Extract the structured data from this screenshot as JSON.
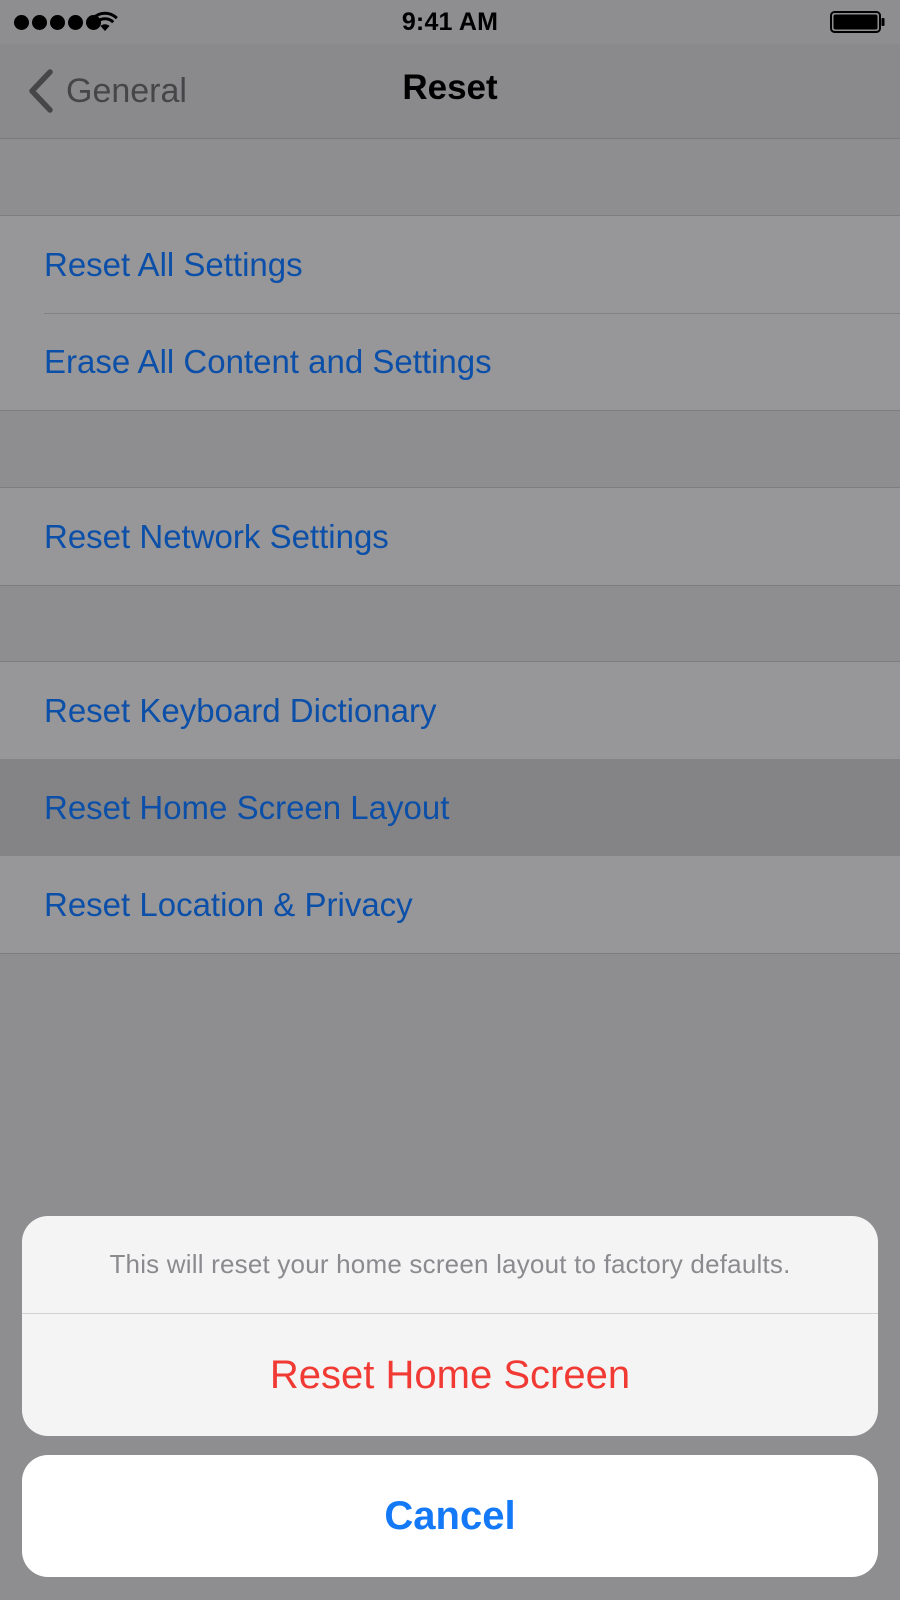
{
  "status_bar": {
    "time": "9:41 AM",
    "signal_icon": "signal-dots-icon",
    "wifi_icon": "wifi-icon",
    "battery_icon": "battery-icon"
  },
  "nav": {
    "back_label": "General",
    "back_icon": "chevron-left-icon",
    "title": "Reset"
  },
  "groups": [
    {
      "items": [
        {
          "label": "Reset All Settings"
        },
        {
          "label": "Erase All Content and Settings"
        }
      ]
    },
    {
      "items": [
        {
          "label": "Reset Network Settings"
        }
      ]
    },
    {
      "items": [
        {
          "label": "Reset Keyboard Dictionary"
        },
        {
          "label": "Reset Home Screen Layout",
          "highlighted": true
        },
        {
          "label": "Reset Location & Privacy"
        }
      ]
    }
  ],
  "action_sheet": {
    "message": "This will reset your home screen layout to factory defaults.",
    "destructive_label": "Reset Home Screen",
    "cancel_label": "Cancel"
  },
  "colors": {
    "link_blue": "#0b4fa8",
    "destructive_red": "#f13a33",
    "cancel_blue": "#1479f7",
    "dim_background": "#8e8e91"
  }
}
